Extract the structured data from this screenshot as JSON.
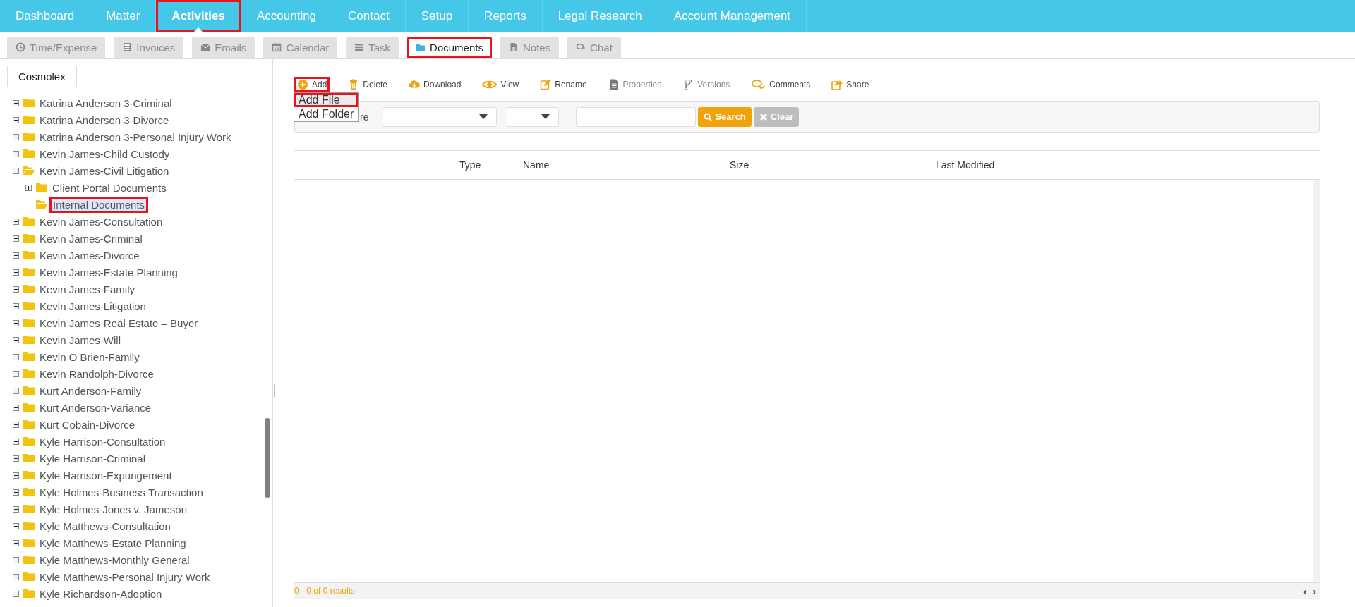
{
  "nav": [
    {
      "label": "Dashboard",
      "selected": false,
      "highlighted": false
    },
    {
      "label": "Matter",
      "selected": false,
      "highlighted": false
    },
    {
      "label": "Activities",
      "selected": true,
      "highlighted": true
    },
    {
      "label": "Accounting",
      "selected": false,
      "highlighted": false
    },
    {
      "label": "Contact",
      "selected": false,
      "highlighted": false
    },
    {
      "label": "Setup",
      "selected": false,
      "highlighted": false
    },
    {
      "label": "Reports",
      "selected": false,
      "highlighted": false
    },
    {
      "label": "Legal Research",
      "selected": false,
      "highlighted": false
    },
    {
      "label": "Account Management",
      "selected": false,
      "highlighted": false
    }
  ],
  "subtabs": [
    {
      "label": "Time/Expense",
      "selected": false,
      "highlighted": false
    },
    {
      "label": "Invoices",
      "selected": false,
      "highlighted": false
    },
    {
      "label": "Emails",
      "selected": false,
      "highlighted": false
    },
    {
      "label": "Calendar",
      "selected": false,
      "highlighted": false
    },
    {
      "label": "Task",
      "selected": false,
      "highlighted": false
    },
    {
      "label": "Documents",
      "selected": true,
      "highlighted": true
    },
    {
      "label": "Notes",
      "selected": false,
      "highlighted": false
    },
    {
      "label": "Chat",
      "selected": false,
      "highlighted": false
    }
  ],
  "sidebar": {
    "tab": "Cosmolex",
    "tree": [
      {
        "label": "Katrina Anderson 3-Criminal",
        "kind": "branch",
        "expanded": false
      },
      {
        "label": "Katrina Anderson 3-Divorce",
        "kind": "branch",
        "expanded": false
      },
      {
        "label": "Katrina Anderson 3-Personal Injury Work",
        "kind": "branch",
        "expanded": false
      },
      {
        "label": "Kevin James-Child Custody",
        "kind": "branch",
        "expanded": false
      },
      {
        "label": "Kevin James-Civil Litigation",
        "kind": "branch",
        "expanded": true,
        "children": [
          {
            "label": "Client Portal Documents",
            "kind": "branch",
            "expanded": false
          },
          {
            "label": "Internal Documents",
            "kind": "leaf",
            "selected": true,
            "highlighted": true
          }
        ]
      },
      {
        "label": "Kevin James-Consultation",
        "kind": "branch",
        "expanded": false
      },
      {
        "label": "Kevin James-Criminal",
        "kind": "branch",
        "expanded": false
      },
      {
        "label": "Kevin James-Divorce",
        "kind": "branch",
        "expanded": false
      },
      {
        "label": "Kevin James-Estate Planning",
        "kind": "branch",
        "expanded": false
      },
      {
        "label": "Kevin James-Family",
        "kind": "branch",
        "expanded": false
      },
      {
        "label": "Kevin James-Litigation",
        "kind": "branch",
        "expanded": false
      },
      {
        "label": "Kevin James-Real Estate – Buyer",
        "kind": "branch",
        "expanded": false
      },
      {
        "label": "Kevin James-Will",
        "kind": "branch",
        "expanded": false
      },
      {
        "label": "Kevin O Brien-Family",
        "kind": "branch",
        "expanded": false
      },
      {
        "label": "Kevin Randolph-Divorce",
        "kind": "branch",
        "expanded": false
      },
      {
        "label": "Kurt Anderson-Family",
        "kind": "branch",
        "expanded": false
      },
      {
        "label": "Kurt Anderson-Variance",
        "kind": "branch",
        "expanded": false
      },
      {
        "label": "Kurt Cobain-Divorce",
        "kind": "branch",
        "expanded": false
      },
      {
        "label": "Kyle Harrison-Consultation",
        "kind": "branch",
        "expanded": false
      },
      {
        "label": "Kyle Harrison-Criminal",
        "kind": "branch",
        "expanded": false
      },
      {
        "label": "Kyle Harrison-Expungement",
        "kind": "branch",
        "expanded": false
      },
      {
        "label": "Kyle Holmes-Business Transaction",
        "kind": "branch",
        "expanded": false
      },
      {
        "label": "Kyle Holmes-Jones v. Jameson",
        "kind": "branch",
        "expanded": false
      },
      {
        "label": "Kyle Matthews-Consultation",
        "kind": "branch",
        "expanded": false
      },
      {
        "label": "Kyle Matthews-Estate Planning",
        "kind": "branch",
        "expanded": false
      },
      {
        "label": "Kyle Matthews-Monthly General",
        "kind": "branch",
        "expanded": false
      },
      {
        "label": "Kyle Matthews-Personal Injury Work",
        "kind": "branch",
        "expanded": false
      },
      {
        "label": "Kyle Richardson-Adoption",
        "kind": "branch",
        "expanded": false
      }
    ]
  },
  "toolbar": [
    {
      "label": "Add",
      "highlighted": true,
      "disabled": false
    },
    {
      "label": "Delete",
      "highlighted": false,
      "disabled": false
    },
    {
      "label": "Download",
      "highlighted": false,
      "disabled": false
    },
    {
      "label": "View",
      "highlighted": false,
      "disabled": false
    },
    {
      "label": "Rename",
      "highlighted": false,
      "disabled": false
    },
    {
      "label": "Properties",
      "highlighted": false,
      "disabled": true
    },
    {
      "label": "Versions",
      "highlighted": false,
      "disabled": true
    },
    {
      "label": "Comments",
      "highlighted": false,
      "disabled": false
    },
    {
      "label": "Share",
      "highlighted": false,
      "disabled": false
    }
  ],
  "add_menu": [
    {
      "label": "Add File",
      "highlighted": true
    },
    {
      "label": "Add Folder",
      "highlighted": false
    }
  ],
  "filter": {
    "label_tail": "re",
    "search_button": "Search",
    "clear_button": "Clear"
  },
  "table": {
    "columns": [
      "Type",
      "Name",
      "Size",
      "Last Modified"
    ]
  },
  "footer": {
    "results": "0 - 0 of 0 results",
    "prev": "‹",
    "next": "›"
  }
}
